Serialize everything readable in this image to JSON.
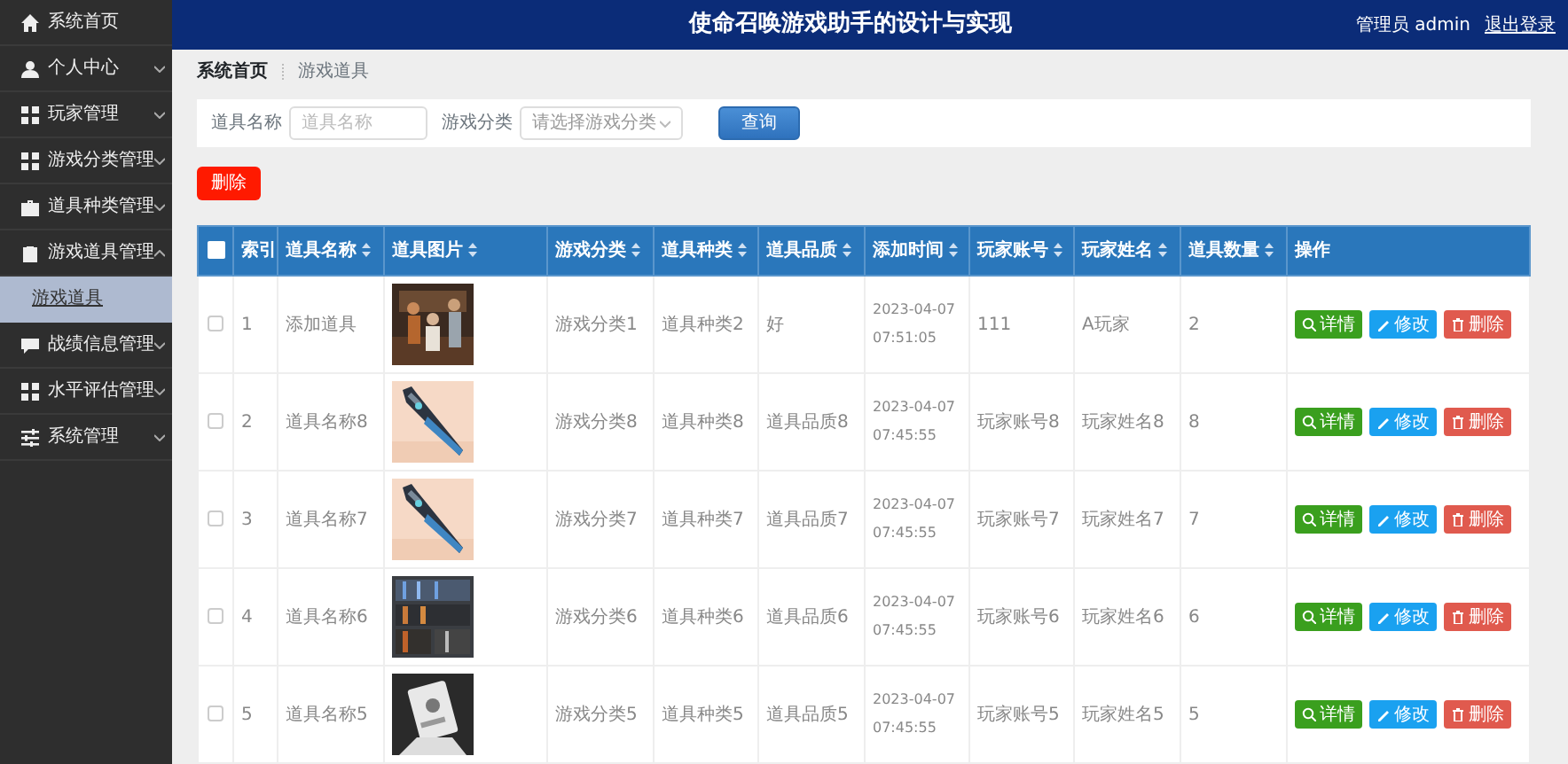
{
  "sidebar": {
    "items": [
      {
        "label": "系统首页",
        "selected": false
      },
      {
        "label": "个人中心",
        "selected": false,
        "expanded": false
      },
      {
        "label": "玩家管理",
        "selected": false,
        "expanded": false
      },
      {
        "label": "游戏分类管理",
        "selected": false,
        "expanded": false
      },
      {
        "label": "道具种类管理",
        "selected": false,
        "expanded": false
      },
      {
        "label": "游戏道具管理",
        "selected": false,
        "expanded": true,
        "children": [
          {
            "label": "游戏道具",
            "selected": true
          }
        ]
      },
      {
        "label": "战绩信息管理",
        "selected": false,
        "expanded": false
      },
      {
        "label": "水平评估管理",
        "selected": false,
        "expanded": false
      },
      {
        "label": "系统管理",
        "selected": false,
        "expanded": false
      }
    ]
  },
  "header": {
    "title": "使命召唤游戏助手的设计与实现",
    "user": "管理员 admin",
    "logout": "退出登录"
  },
  "breadcrumb": [
    "系统首页",
    "游戏道具"
  ],
  "search": {
    "fields": [
      {
        "label": "道具名称",
        "kind": "input",
        "placeholder": "道具名称"
      },
      {
        "label": "游戏分类",
        "kind": "select",
        "placeholder": "请选择游戏分类"
      }
    ],
    "button": "查询"
  },
  "delete_button": "删除",
  "table": {
    "select_all": {
      "checked": false
    },
    "columns": [
      {
        "label": "索引"
      },
      {
        "label": "道具名称",
        "sortable": true
      },
      {
        "label": "道具图片",
        "sortable": true
      },
      {
        "label": "游戏分类",
        "sortable": true
      },
      {
        "label": "道具种类",
        "sortable": true
      },
      {
        "label": "道具品质",
        "sortable": true
      },
      {
        "label": "添加时间",
        "sortable": true
      },
      {
        "label": "玩家账号",
        "sortable": true
      },
      {
        "label": "玩家姓名",
        "sortable": true
      },
      {
        "label": "道具数量",
        "sortable": true
      },
      {
        "label": "操作"
      }
    ],
    "rows": [
      {
        "checked": false,
        "actions": [
          "详情",
          "修改",
          "删除"
        ],
        "index": "1",
        "name": "添加道具",
        "category": "游戏分类1",
        "type": "道具种类2",
        "quality": "好",
        "time": "2023-04-07 07:51:05",
        "account": "111",
        "player": "A玩家",
        "count": "2"
      },
      {
        "checked": false,
        "actions": [
          "详情",
          "修改",
          "删除"
        ],
        "index": "2",
        "name": "道具名称8",
        "category": "游戏分类8",
        "type": "道具种类8",
        "quality": "道具品质8",
        "time": "2023-04-07 07:45:55",
        "account": "玩家账号8",
        "player": "玩家姓名8",
        "count": "8"
      },
      {
        "checked": false,
        "actions": [
          "详情",
          "修改",
          "删除"
        ],
        "index": "3",
        "name": "道具名称7",
        "category": "游戏分类7",
        "type": "道具种类7",
        "quality": "道具品质7",
        "time": "2023-04-07 07:45:55",
        "account": "玩家账号7",
        "player": "玩家姓名7",
        "count": "7"
      },
      {
        "checked": false,
        "actions": [
          "详情",
          "修改",
          "删除"
        ],
        "index": "4",
        "name": "道具名称6",
        "category": "游戏分类6",
        "type": "道具种类6",
        "quality": "道具品质6",
        "time": "2023-04-07 07:45:55",
        "account": "玩家账号6",
        "player": "玩家姓名6",
        "count": "6"
      },
      {
        "checked": false,
        "actions": [
          "详情",
          "修改",
          "删除"
        ],
        "index": "5",
        "name": "道具名称5",
        "category": "游戏分类5",
        "type": "道具种类5",
        "quality": "道具品质5",
        "time": "2023-04-07 07:45:55",
        "account": "玩家账号5",
        "player": "玩家姓名5",
        "count": "5"
      }
    ]
  }
}
